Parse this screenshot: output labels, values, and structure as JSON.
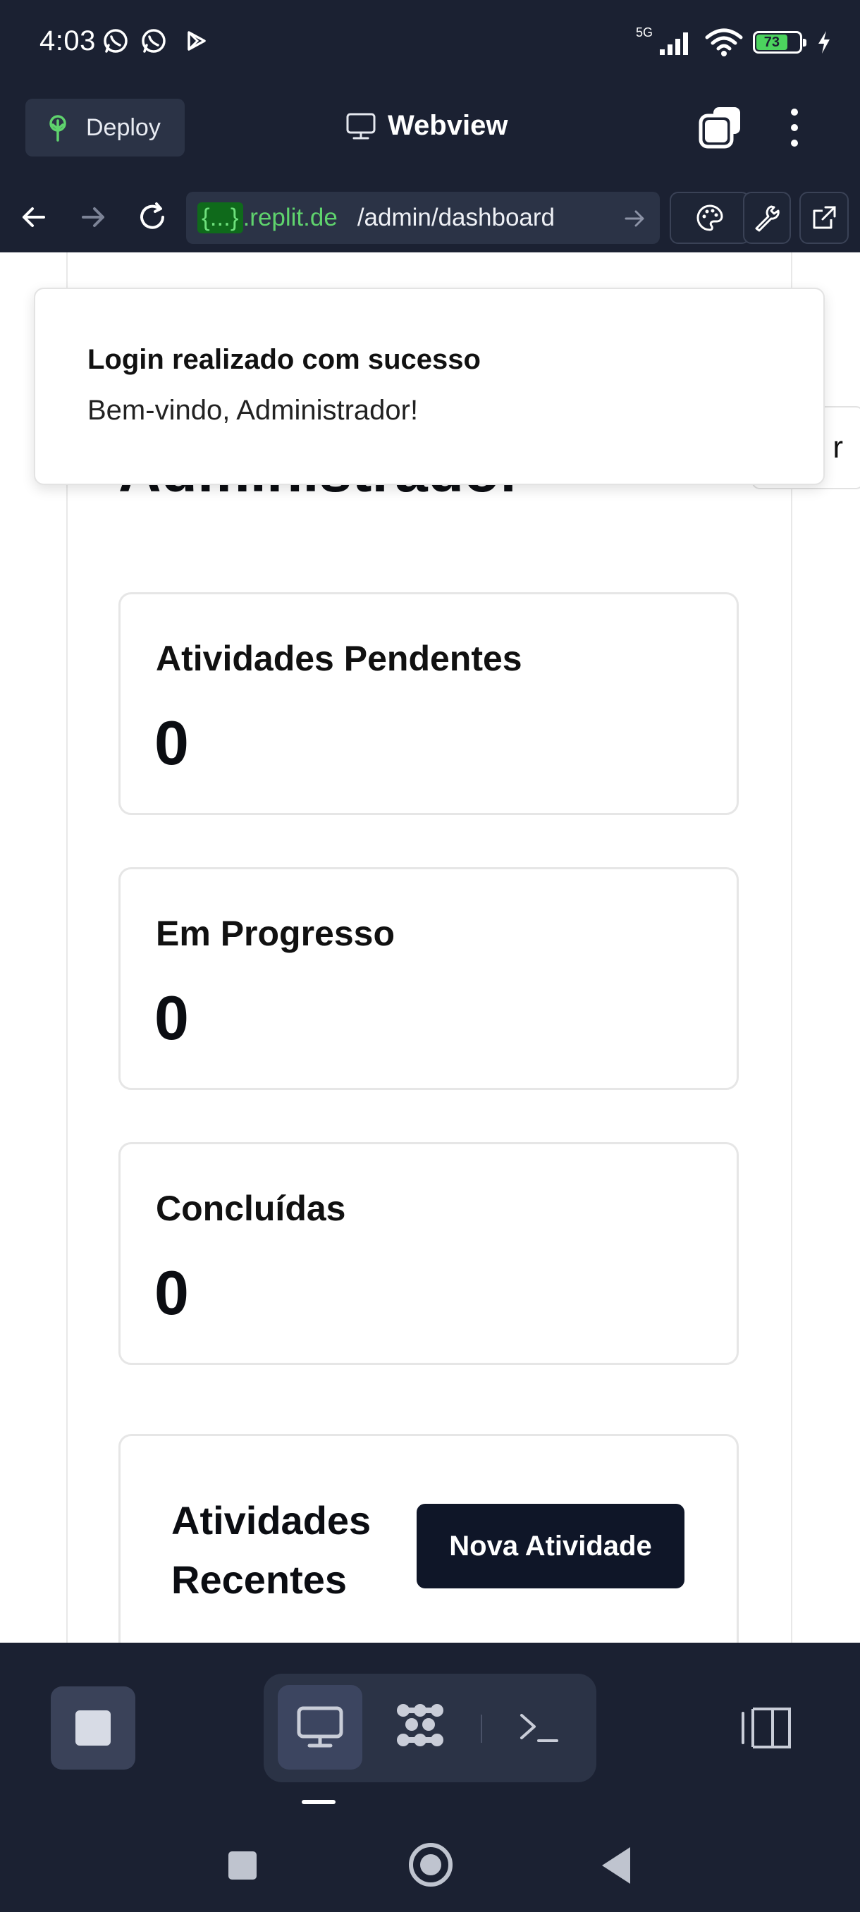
{
  "status_bar": {
    "time": "4:03",
    "network": "5G",
    "battery_level": "73",
    "battery_fraction": 0.73
  },
  "top_bar": {
    "deploy_label": "Deploy",
    "title": "Webview"
  },
  "url_bar": {
    "host_prefix": "{...}",
    "host": ".replit.de",
    "path": "/admin/dashboard"
  },
  "toast": {
    "title": "Login realizado com sucesso",
    "message": "Bem-vindo, Administrador!"
  },
  "page": {
    "title": "Administrador",
    "right_button_fragment": "r"
  },
  "stats": [
    {
      "label": "Atividades Pendentes",
      "value": "0"
    },
    {
      "label": "Em Progresso",
      "value": "0"
    },
    {
      "label": "Concluídas",
      "value": "0"
    }
  ],
  "recent": {
    "title": "Atividades Recentes",
    "new_button": "Nova Atividade"
  },
  "icons": {
    "whatsapp": "whatsapp-icon",
    "play": "play-store-icon",
    "deploy": "deploy-tree-icon",
    "webview": "monitor-icon",
    "terminal": "terminal-icon",
    "workspace": "workspace-grid-icon"
  },
  "colors": {
    "chrome_bg": "#1b2132",
    "chrome_surface": "#2b3346",
    "url_host": "#5fd36d",
    "primary_button": "#0f1628"
  }
}
